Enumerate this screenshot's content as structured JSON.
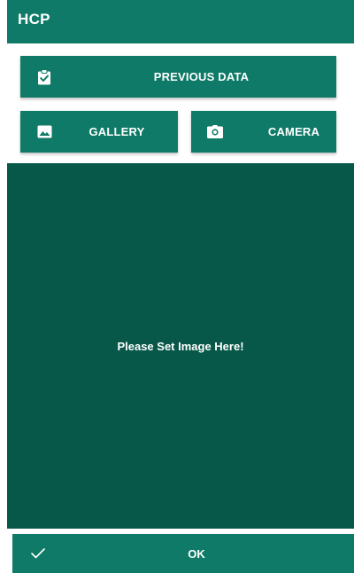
{
  "appbar": {
    "title": "HCP"
  },
  "buttons": {
    "previous_data": {
      "label": "PREVIOUS DATA",
      "icon": "clipboard-check-icon"
    },
    "gallery": {
      "label": "GALLERY",
      "icon": "image-icon"
    },
    "camera": {
      "label": "CAMERA",
      "icon": "camera-icon"
    }
  },
  "preview": {
    "placeholder": "Please Set Image Here!"
  },
  "footer": {
    "ok_label": "OK",
    "icon": "check-icon"
  },
  "colors": {
    "primary": "#0f7a67",
    "preview_bg": "#075849",
    "text": "#ffffff"
  }
}
